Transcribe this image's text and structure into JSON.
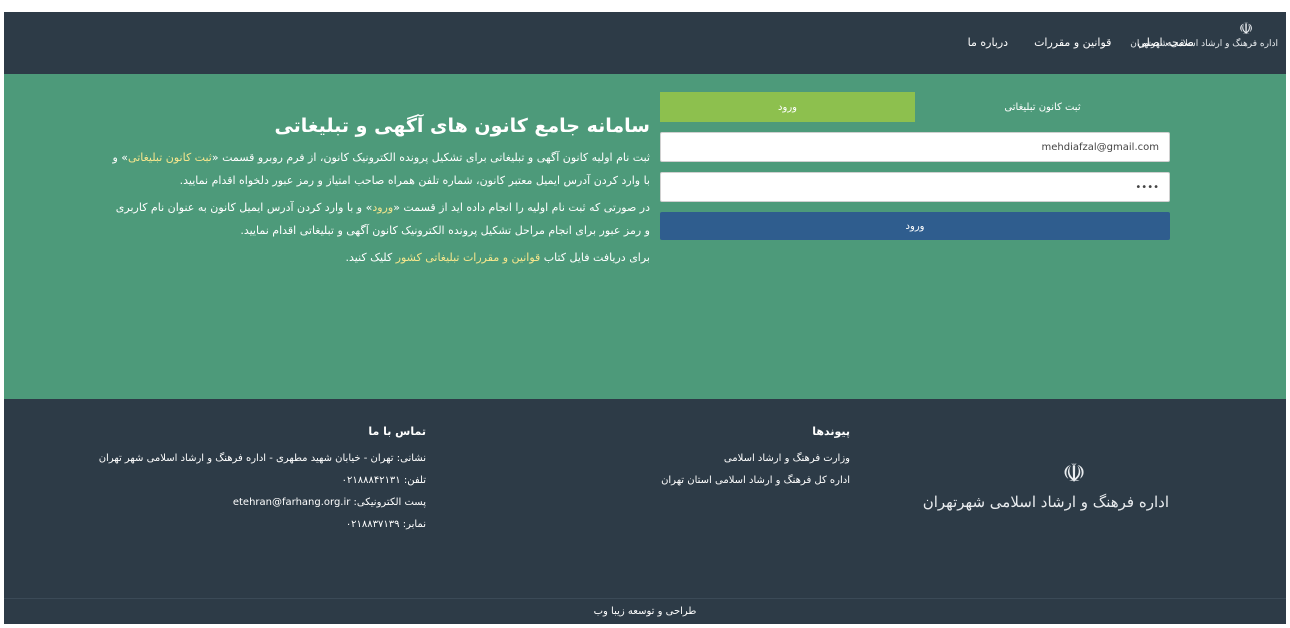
{
  "nav": {
    "logo_text": "اداره فرهنگ و ارشاد اسلامی شهرتهران",
    "links": [
      "صفحه اصلی",
      "قوانین و مقررات",
      "درباره ما"
    ]
  },
  "hero": {
    "title": "سامانه جامع کانون های آگهی و تبلیغاتی",
    "para1_a": "ثبت نام اولیه کانون آگهی و تبلیغاتی برای تشکیل پرونده الکترونیک کانون، از فرم روبرو قسمت «",
    "para1_hl": "ثبت کانون تبلیغاتی",
    "para1_b": "» و با وارد کردن آدرس ایمیل معتبر کانون، شماره تلفن همراه صاحب امتیاز و رمز عبور دلخواه اقدام نمایید.",
    "para2_a": "در صورتی که ثبت نام اولیه را انجام داده اید از قسمت «",
    "para2_hl": "ورود",
    "para2_b": "» و با وارد کردن آدرس ایمیل کانون به عنوان نام کاربری و رمز عبور برای انجام مراحل تشکیل پرونده الکترونیک کانون آگهی و تبلیغاتی اقدام نمایید.",
    "para3_a": "برای دریافت فایل کتاب ",
    "para3_hl": "قوانین و مقررات تبلیغاتی کشور",
    "para3_b": " کلیک کنید."
  },
  "login": {
    "tab_register": "ثبت کانون تبلیغاتی",
    "tab_login": "ورود",
    "email_value": "mehdiafzal@gmail.com",
    "password_value": "••••",
    "submit_label": "ورود"
  },
  "footer": {
    "logo_text": "اداره فرهنگ و ارشاد اسلامی شهرتهران",
    "links_title": "پیوندها",
    "links": [
      "وزارت فرهنگ و ارشاد اسلامی",
      "اداره کل فرهنگ و ارشاد اسلامی استان تهران"
    ],
    "contact_title": "تماس با ما",
    "address": "نشانی: تهران - خیابان شهید مطهری - اداره فرهنگ و ارشاد اسلامی شهر تهران",
    "phone": "تلفن: ۰۲۱۸۸۸۴۲۱۳۱",
    "email": "پست الکترونیکی: etehran@farhang.org.ir",
    "fax": "نمابر: ۰۲۱۸۸۳۷۱۳۹"
  },
  "credit": "طراحی و توسعه زیبا وب"
}
